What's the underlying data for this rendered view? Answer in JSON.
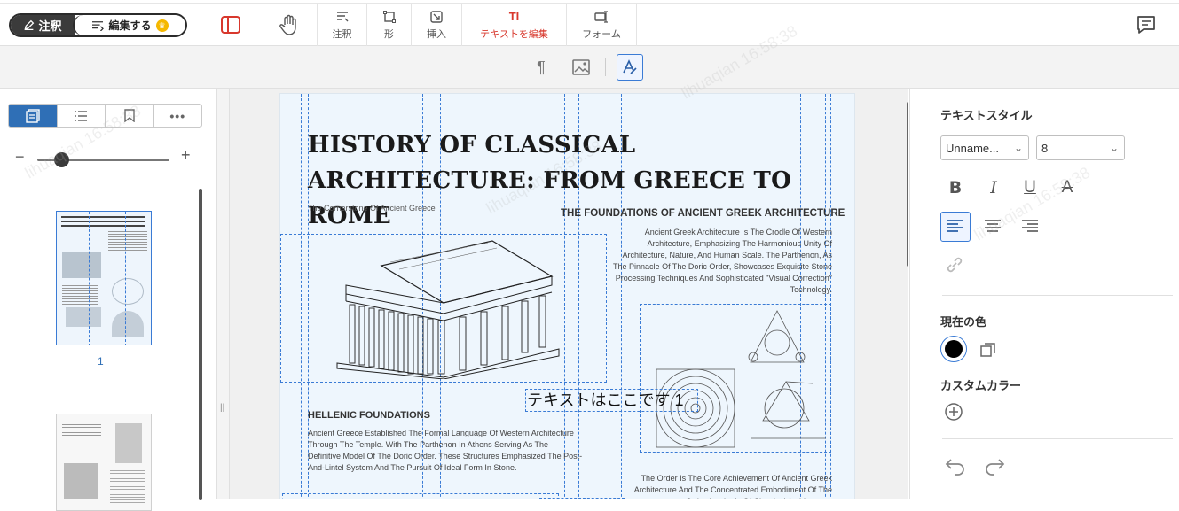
{
  "toolbar": {
    "mode_annotate": "注釈",
    "mode_edit": "編集する",
    "tools": [
      {
        "label": "注釈",
        "icon": "annotation-icon"
      },
      {
        "label": "形",
        "icon": "shape-icon"
      },
      {
        "label": "挿入",
        "icon": "insert-icon"
      },
      {
        "label": "テキストを編集",
        "icon": "edit-text-icon"
      },
      {
        "label": "フォーム",
        "icon": "form-icon"
      }
    ],
    "accent_color": "#d8382d"
  },
  "subtoolbar": {
    "icons": [
      "paragraph-icon",
      "image-icon",
      "text-style-icon"
    ]
  },
  "sidebar": {
    "tabs": [
      "thumbnails-icon",
      "outline-icon",
      "bookmark-icon",
      "more-icon"
    ],
    "zoom_minus": "−",
    "zoom_plus": "+",
    "zoom_level": 0.13,
    "page_number": "1"
  },
  "document": {
    "title": "HISTORY OF CLASSICAL  ARCHITECTURE: FROM GREECE TO ROME",
    "subtitle": "The Cornerstone Of Ancient Greece",
    "right_heading": "THE FOUNDATIONS OF ANCIENT GREEK ARCHITECTURE",
    "right_paragraph": "Ancient Greek Architecture Is The Crodle Of Western Architecture, Emphasizing The Harmonious Unity Of Architecture, Nature, And Human Scale. The Parthenon, As The Pinnacle Of The Doric Order, Showcases Exquisite Stone Processing Techniques And Sophisticated \"Visual Correction\" Technology.",
    "text_box": "テキストはここです 1",
    "left_heading": "HELLENIC FOUNDATIONS",
    "left_paragraph": "Ancient Greece Established The Formal Language Of Western Architecture Through The Temple. With The Parthenon In Athens Serving As The Definitive Model Of The Doric Order. These Structures Emphasized The Post-And-Lintel System And The Pursuit Of Ideal Form In Stone.",
    "bottom_paragraph": "The Order Is The Core Achievement Of Ancient Greek Architecture And The Concentrated Embodiment Of The Order Aesthetic Of Classical Architecture."
  },
  "properties": {
    "title": "テキストスタイル",
    "font_name": "Unname...",
    "font_size": "8",
    "format_buttons": [
      "bold-icon",
      "italic-icon",
      "underline-icon",
      "strikethrough-icon"
    ],
    "align_buttons": [
      "align-left-icon",
      "align-center-icon",
      "align-right-icon"
    ],
    "current_color_label": "現在の色",
    "current_color": "#000000",
    "custom_color_label": "カスタムカラー"
  },
  "watermark": "lihuaqian 16:58:38"
}
